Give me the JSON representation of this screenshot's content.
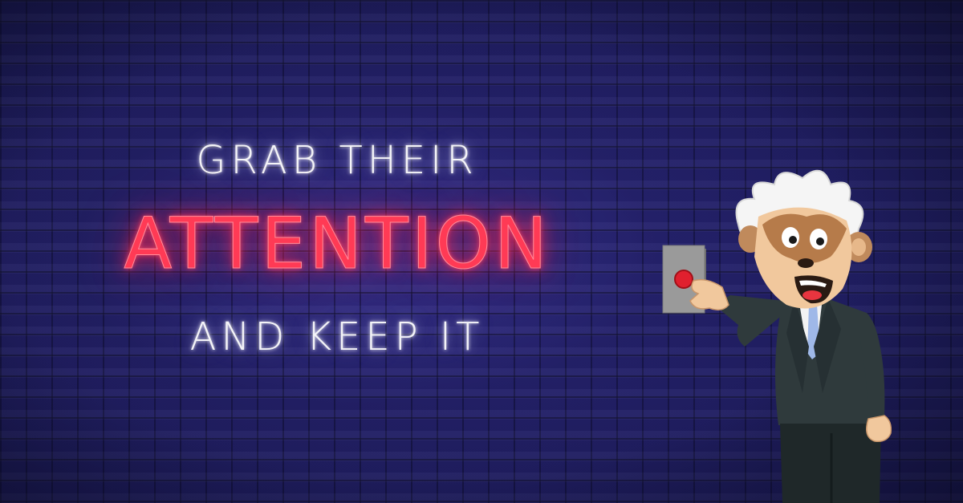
{
  "headline": {
    "line1": "GRAB THEIR",
    "line2": "ATTENTION",
    "line3": "AND KEEP IT"
  },
  "colors": {
    "background": "#1f1d60",
    "neon_white": "#f4f4f8",
    "neon_red": "#ff3a55",
    "button_red": "#e0202e",
    "suit": "#2f3a3c"
  },
  "illustration": {
    "subject": "monkey-scientist-pressing-red-button"
  }
}
